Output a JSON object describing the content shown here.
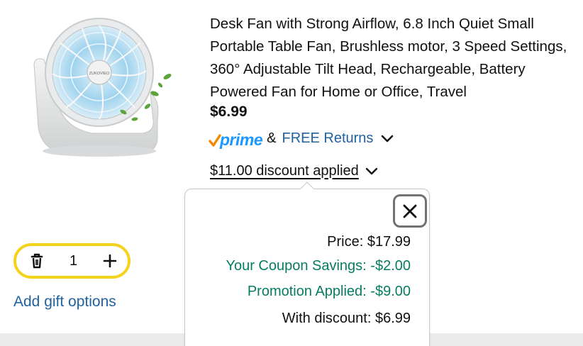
{
  "product": {
    "title": "Desk Fan with Strong Airflow, 6.8 Inch Quiet Small Portable Table Fan, Brushless motor, 3 Speed Settings, 360° Adjustable Tilt Head, Rechargeable, Battery Powered Fan for Home or Office, Travel",
    "price": "$6.99",
    "image_brand_text": "ZUKOVIEO"
  },
  "shipping": {
    "prime_label": "prime",
    "ampersand": "&",
    "free_returns_label": "FREE Returns"
  },
  "discount": {
    "applied_label": "$11.00 discount applied"
  },
  "cart": {
    "quantity": "1",
    "gift_options_label": "Add gift options"
  },
  "popover": {
    "price_line": "Price: $17.99",
    "coupon_line": "Your Coupon Savings: -$2.00",
    "promotion_line": "Promotion Applied: -$9.00",
    "final_line": "With discount: $6.99"
  },
  "colors": {
    "link": "#2162a1",
    "savings_green": "#067d62",
    "prime_blue": "#1a98ff",
    "prime_check_orange": "#f08804",
    "stepper_border": "#f5d21b"
  },
  "icons": {
    "prime": "prime-check-icon",
    "returns_toggle": "chevron-down-icon",
    "discount_toggle": "chevron-down-icon",
    "delete": "trash-icon",
    "increment": "plus-icon",
    "close": "close-icon"
  }
}
